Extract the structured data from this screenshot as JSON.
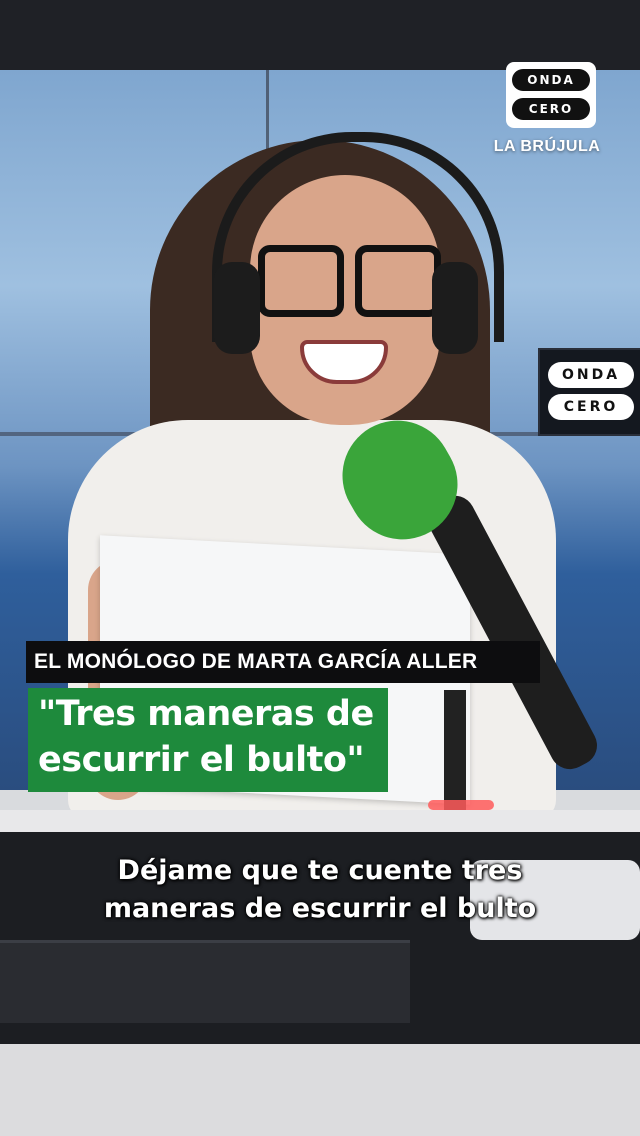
{
  "brand": {
    "logo_top": "ONDA",
    "logo_bottom": "CERO",
    "program": "LA BRÚJULA"
  },
  "studio_wall": {
    "side_logo_top": "ONDA",
    "side_logo_bottom": "CERO"
  },
  "overlay": {
    "show_label": "EL MONÓLOGO DE MARTA GARCÍA ALLER",
    "title_line_1": "\"Tres maneras de",
    "title_line_2": "escurrir el bulto\""
  },
  "caption": {
    "line_1": "Déjame que te cuente tres",
    "line_2": "maneras de escurrir el bulto"
  },
  "colors": {
    "title_green": "#1e8a3c",
    "label_black": "#0d0d0f",
    "mic_green": "#3aa53a"
  }
}
